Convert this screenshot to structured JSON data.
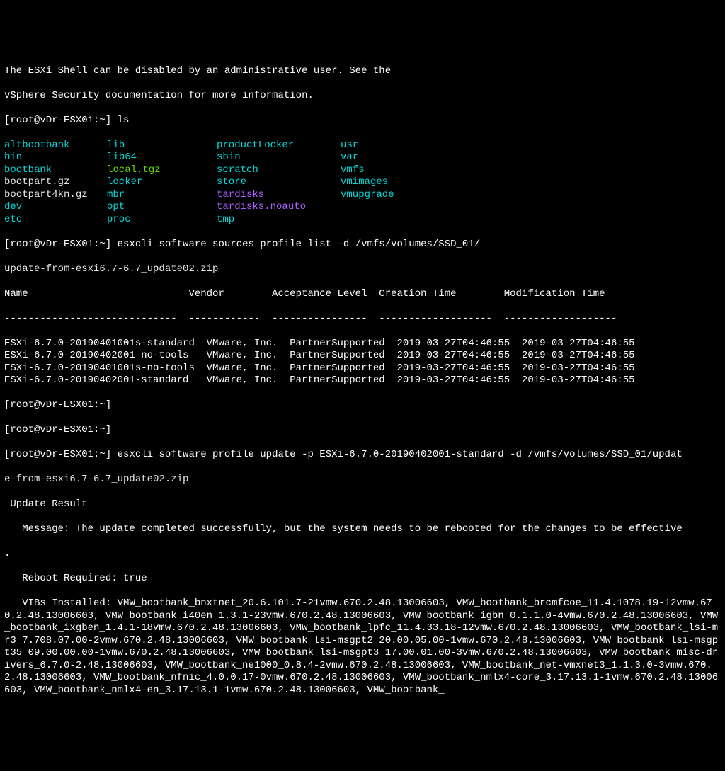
{
  "intro": {
    "line1": "The ESXi Shell can be disabled by an administrative user. See the",
    "line2": "vSphere Security documentation for more information."
  },
  "prompts": {
    "p1": "[root@vDr-ESX01:~]",
    "p2": "[root@vDr-ESX01:~]",
    "p3": "[root@vDr-ESX01:~]",
    "p4": "[root@vDr-ESX01:~]",
    "p5": "[root@vDr-ESX01:~]"
  },
  "cmds": {
    "ls": " ls",
    "profile_list": " esxcli software sources profile list -d /vmfs/volumes/SSD_01/",
    "profile_list_cont": "update-from-esxi6.7-6.7_update02.zip",
    "empty1": "",
    "empty2": "",
    "profile_update": " esxcli software profile update -p ESXi-6.7.0-20190402001-standard -d /vmfs/volumes/SSD_01/updat",
    "profile_update_cont": "e-from-esxi6.7-6.7_update02.zip"
  },
  "ls": {
    "rows": [
      {
        "c1": {
          "t": "altbootbank",
          "cls": "cyan"
        },
        "c2": {
          "t": "lib",
          "cls": "cyan"
        },
        "c3": {
          "t": "productLocker",
          "cls": "cyan"
        },
        "c4": {
          "t": "usr",
          "cls": "cyan"
        }
      },
      {
        "c1": {
          "t": "bin",
          "cls": "cyan"
        },
        "c2": {
          "t": "lib64",
          "cls": "cyan"
        },
        "c3": {
          "t": "sbin",
          "cls": "cyan"
        },
        "c4": {
          "t": "var",
          "cls": "cyan"
        }
      },
      {
        "c1": {
          "t": "bootbank",
          "cls": "cyan"
        },
        "c2": {
          "t": "local.tgz",
          "cls": "green"
        },
        "c3": {
          "t": "scratch",
          "cls": "cyan"
        },
        "c4": {
          "t": "vmfs",
          "cls": "cyan"
        }
      },
      {
        "c1": {
          "t": "bootpart.gz",
          "cls": "white"
        },
        "c2": {
          "t": "locker",
          "cls": "cyan"
        },
        "c3": {
          "t": "store",
          "cls": "cyan"
        },
        "c4": {
          "t": "vmimages",
          "cls": "cyan"
        }
      },
      {
        "c1": {
          "t": "bootpart4kn.gz",
          "cls": "white"
        },
        "c2": {
          "t": "mbr",
          "cls": "cyan"
        },
        "c3": {
          "t": "tardisks",
          "cls": "magenta"
        },
        "c4": {
          "t": "vmupgrade",
          "cls": "cyan"
        }
      },
      {
        "c1": {
          "t": "dev",
          "cls": "cyan"
        },
        "c2": {
          "t": "opt",
          "cls": "cyan"
        },
        "c3": {
          "t": "tardisks.noauto",
          "cls": "magenta"
        },
        "c4": {
          "t": "",
          "cls": ""
        }
      },
      {
        "c1": {
          "t": "etc",
          "cls": "cyan"
        },
        "c2": {
          "t": "proc",
          "cls": "cyan"
        },
        "c3": {
          "t": "tmp",
          "cls": "cyan"
        },
        "c4": {
          "t": "",
          "cls": ""
        }
      }
    ]
  },
  "table": {
    "header": "Name                           Vendor        Acceptance Level  Creation Time        Modification Time",
    "divider": "-----------------------------  ------------  ----------------  -------------------  -------------------",
    "rows": [
      "ESXi-6.7.0-20190401001s-standard  VMware, Inc.  PartnerSupported  2019-03-27T04:46:55  2019-03-27T04:46:55",
      "ESXi-6.7.0-20190402001-no-tools   VMware, Inc.  PartnerSupported  2019-03-27T04:46:55  2019-03-27T04:46:55",
      "ESXi-6.7.0-20190401001s-no-tools  VMware, Inc.  PartnerSupported  2019-03-27T04:46:55  2019-03-27T04:46:55",
      "ESXi-6.7.0-20190402001-standard   VMware, Inc.  PartnerSupported  2019-03-27T04:46:55  2019-03-27T04:46:55"
    ]
  },
  "update_result": {
    "header": " Update Result",
    "message": "   Message: The update completed successfully, but the system needs to be rebooted for the changes to be effective",
    "dot": ".",
    "reboot": "   Reboot Required: true",
    "vibs": "   VIBs Installed: VMW_bootbank_bnxtnet_20.6.101.7-21vmw.670.2.48.13006603, VMW_bootbank_brcmfcoe_11.4.1078.19-12vmw.670.2.48.13006603, VMW_bootbank_i40en_1.3.1-23vmw.670.2.48.13006603, VMW_bootbank_igbn_0.1.1.0-4vmw.670.2.48.13006603, VMW_bootbank_ixgben_1.4.1-18vmw.670.2.48.13006603, VMW_bootbank_lpfc_11.4.33.18-12vmw.670.2.48.13006603, VMW_bootbank_lsi-mr3_7.708.07.00-2vmw.670.2.48.13006603, VMW_bootbank_lsi-msgpt2_20.00.05.00-1vmw.670.2.48.13006603, VMW_bootbank_lsi-msgpt35_09.00.00.00-1vmw.670.2.48.13006603, VMW_bootbank_lsi-msgpt3_17.00.01.00-3vmw.670.2.48.13006603, VMW_bootbank_misc-drivers_6.7.0-2.48.13006603, VMW_bootbank_ne1000_0.8.4-2vmw.670.2.48.13006603, VMW_bootbank_net-vmxnet3_1.1.3.0-3vmw.670.2.48.13006603, VMW_bootbank_nfnic_4.0.0.17-0vmw.670.2.48.13006603, VMW_bootbank_nmlx4-core_3.17.13.1-1vmw.670.2.48.13006603, VMW_bootbank_nmlx4-en_3.17.13.1-1vmw.670.2.48.13006603, VMW_bootbank_"
  }
}
